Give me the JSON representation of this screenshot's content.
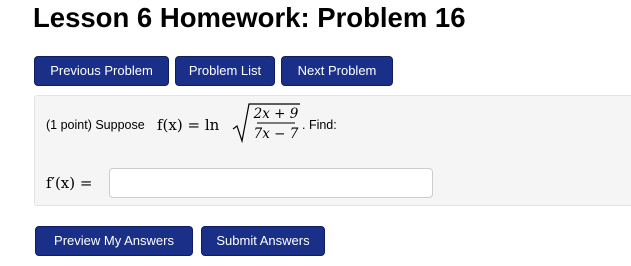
{
  "page": {
    "title": "Lesson 6 Homework: Problem 16"
  },
  "nav": {
    "previous_label": "Previous Problem",
    "list_label": "Problem List",
    "next_label": "Next Problem"
  },
  "problem": {
    "points_text": "(1 point) Suppose",
    "function_lhs": "f(x) = ln",
    "numerator": "2x + 9",
    "denominator": "7x − 7",
    "find_text": ". Find:",
    "answer_label": "f′(x) =",
    "answer_value": "",
    "answer_placeholder": ""
  },
  "actions": {
    "preview_label": "Preview My Answers",
    "submit_label": "Submit Answers"
  },
  "colors": {
    "button_bg": "#1a2f87",
    "panel_bg": "#f5f5f5"
  }
}
